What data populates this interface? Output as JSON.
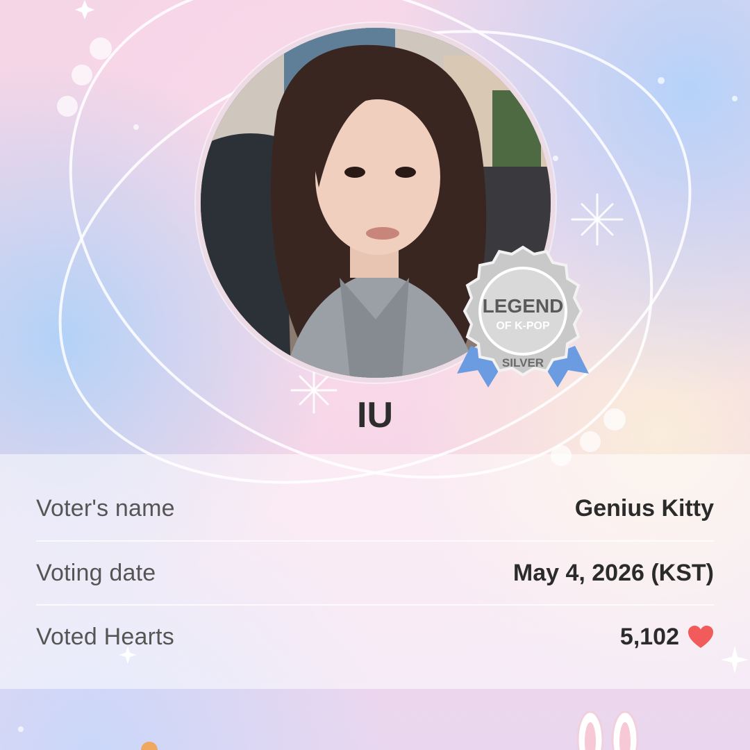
{
  "artist": {
    "name": "IU",
    "photo_alt": "IU"
  },
  "badge": {
    "title": "LEGEND",
    "subtitle": "OF K-POP",
    "tier": "SILVER"
  },
  "vote_info": {
    "rows": [
      {
        "label": "Voter's name",
        "value": "Genius Kitty"
      },
      {
        "label": "Voting date",
        "value": "May 4, 2026 (KST)"
      },
      {
        "label": "Voted Hearts",
        "value": "5,102"
      }
    ],
    "heart_icon": "heart-icon",
    "heart_color": "#f15b5b"
  },
  "colors": {
    "background_pink": "#f3d6e6",
    "background_blue": "#b4d2f8",
    "badge_silver": "#c9c9c9",
    "ribbon_blue": "#6b9be0",
    "text_dark": "#2d2d2d"
  }
}
